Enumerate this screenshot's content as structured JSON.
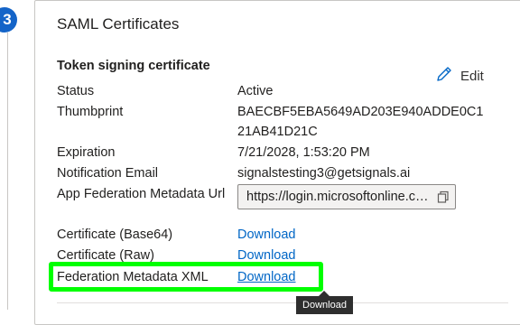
{
  "step": {
    "number": "3"
  },
  "card": {
    "title": "SAML Certificates",
    "section_title": "Token signing certificate",
    "edit_label": "Edit",
    "rows": {
      "status": {
        "label": "Status",
        "value": "Active"
      },
      "thumbprint": {
        "label": "Thumbprint",
        "value": "BAECBF5EBA5649AD203E940ADDE0C121AB41D21C"
      },
      "expiration": {
        "label": "Expiration",
        "value": "7/21/2028, 1:53:20 PM"
      },
      "notification_email": {
        "label": "Notification Email",
        "value": "signalstesting3@getsignals.ai"
      },
      "app_federation_metadata_url": {
        "label": "App Federation Metadata Url",
        "value": "https://login.microsoftonline.com/"
      },
      "certificate_base64": {
        "label": "Certificate (Base64)",
        "value": "Download"
      },
      "certificate_raw": {
        "label": "Certificate (Raw)",
        "value": "Download"
      },
      "federation_metadata_xml": {
        "label": "Federation Metadata XML",
        "value": "Download"
      }
    }
  },
  "tooltip": {
    "text": "Download"
  },
  "colors": {
    "accent": "#0066c6",
    "badge": "#1464c8",
    "highlight": "#00ff00"
  },
  "icons": {
    "edit": "pencil-icon",
    "copy": "copy-icon"
  }
}
